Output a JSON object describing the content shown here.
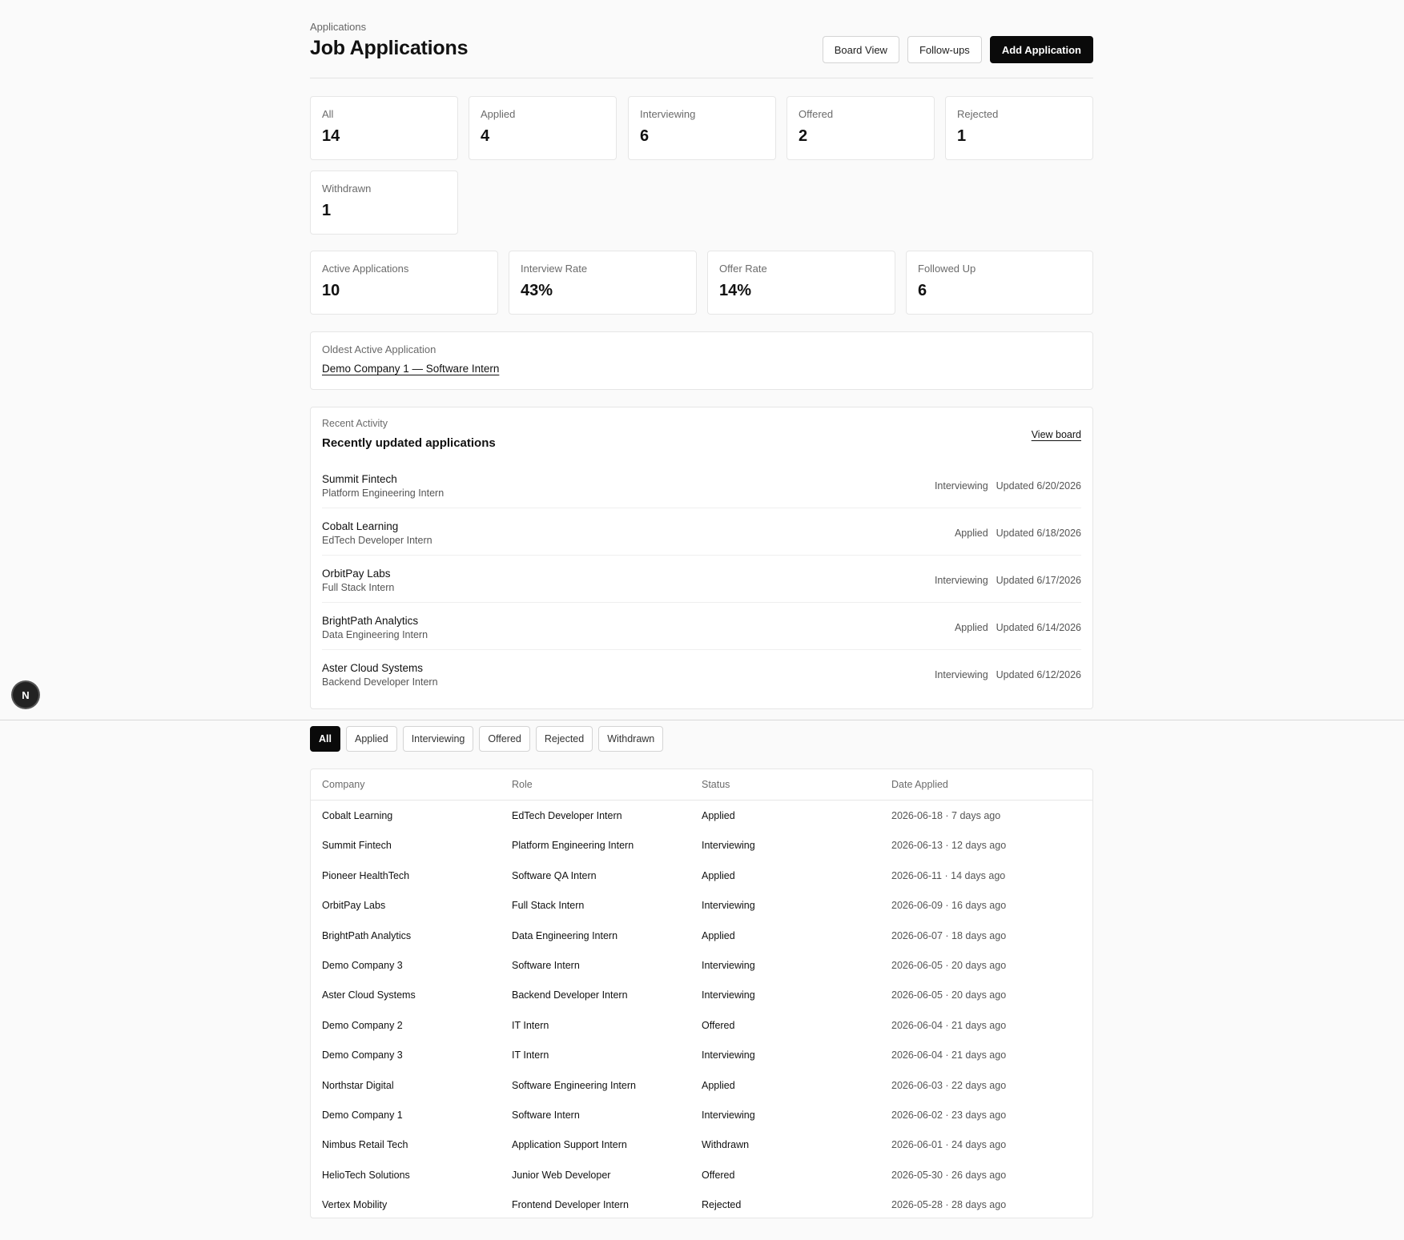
{
  "header": {
    "breadcrumb": "Applications",
    "title": "Job Applications",
    "board_view_label": "Board View",
    "follow_ups_label": "Follow-ups",
    "add_application_label": "Add Application"
  },
  "status_counts": [
    {
      "label": "All",
      "value": "14"
    },
    {
      "label": "Applied",
      "value": "4"
    },
    {
      "label": "Interviewing",
      "value": "6"
    },
    {
      "label": "Offered",
      "value": "2"
    },
    {
      "label": "Rejected",
      "value": "1"
    },
    {
      "label": "Withdrawn",
      "value": "1"
    }
  ],
  "metrics": [
    {
      "label": "Active Applications",
      "value": "10"
    },
    {
      "label": "Interview Rate",
      "value": "43%"
    },
    {
      "label": "Offer Rate",
      "value": "14%"
    },
    {
      "label": "Followed Up",
      "value": "6"
    }
  ],
  "oldest_active": {
    "label": "Oldest Active Application",
    "link": "Demo Company 1 — Software Intern"
  },
  "recent_activity": {
    "eyebrow": "Recent Activity",
    "title": "Recently updated applications",
    "view_board_label": "View board",
    "items": [
      {
        "company": "Summit Fintech",
        "role": "Platform Engineering Intern",
        "status": "Interviewing",
        "updated": "Updated 6/20/2026"
      },
      {
        "company": "Cobalt Learning",
        "role": "EdTech Developer Intern",
        "status": "Applied",
        "updated": "Updated 6/18/2026"
      },
      {
        "company": "OrbitPay Labs",
        "role": "Full Stack Intern",
        "status": "Interviewing",
        "updated": "Updated 6/17/2026"
      },
      {
        "company": "BrightPath Analytics",
        "role": "Data Engineering Intern",
        "status": "Applied",
        "updated": "Updated 6/14/2026"
      },
      {
        "company": "Aster Cloud Systems",
        "role": "Backend Developer Intern",
        "status": "Interviewing",
        "updated": "Updated 6/12/2026"
      }
    ]
  },
  "badge": {
    "letter": "N"
  },
  "filters": [
    "All",
    "Applied",
    "Interviewing",
    "Offered",
    "Rejected",
    "Withdrawn"
  ],
  "table": {
    "headers": [
      "Company",
      "Role",
      "Status",
      "Date Applied"
    ],
    "rows": [
      {
        "company": "Cobalt Learning",
        "role": "EdTech Developer Intern",
        "status": "Applied",
        "date": "2026-06-18 · 7 days ago"
      },
      {
        "company": "Summit Fintech",
        "role": "Platform Engineering Intern",
        "status": "Interviewing",
        "date": "2026-06-13 · 12 days ago"
      },
      {
        "company": "Pioneer HealthTech",
        "role": "Software QA Intern",
        "status": "Applied",
        "date": "2026-06-11 · 14 days ago"
      },
      {
        "company": "OrbitPay Labs",
        "role": "Full Stack Intern",
        "status": "Interviewing",
        "date": "2026-06-09 · 16 days ago"
      },
      {
        "company": "BrightPath Analytics",
        "role": "Data Engineering Intern",
        "status": "Applied",
        "date": "2026-06-07 · 18 days ago"
      },
      {
        "company": "Demo Company 3",
        "role": "Software Intern",
        "status": "Interviewing",
        "date": "2026-06-05 · 20 days ago"
      },
      {
        "company": "Aster Cloud Systems",
        "role": "Backend Developer Intern",
        "status": "Interviewing",
        "date": "2026-06-05 · 20 days ago"
      },
      {
        "company": "Demo Company 2",
        "role": "IT Intern",
        "status": "Offered",
        "date": "2026-06-04 · 21 days ago"
      },
      {
        "company": "Demo Company 3",
        "role": "IT Intern",
        "status": "Interviewing",
        "date": "2026-06-04 · 21 days ago"
      },
      {
        "company": "Northstar Digital",
        "role": "Software Engineering Intern",
        "status": "Applied",
        "date": "2026-06-03 · 22 days ago"
      },
      {
        "company": "Demo Company 1",
        "role": "Software Intern",
        "status": "Interviewing",
        "date": "2026-06-02 · 23 days ago"
      },
      {
        "company": "Nimbus Retail Tech",
        "role": "Application Support Intern",
        "status": "Withdrawn",
        "date": "2026-06-01 · 24 days ago"
      },
      {
        "company": "HelioTech Solutions",
        "role": "Junior Web Developer",
        "status": "Offered",
        "date": "2026-05-30 · 26 days ago"
      },
      {
        "company": "Vertex Mobility",
        "role": "Frontend Developer Intern",
        "status": "Rejected",
        "date": "2026-05-28 · 28 days ago"
      }
    ]
  }
}
